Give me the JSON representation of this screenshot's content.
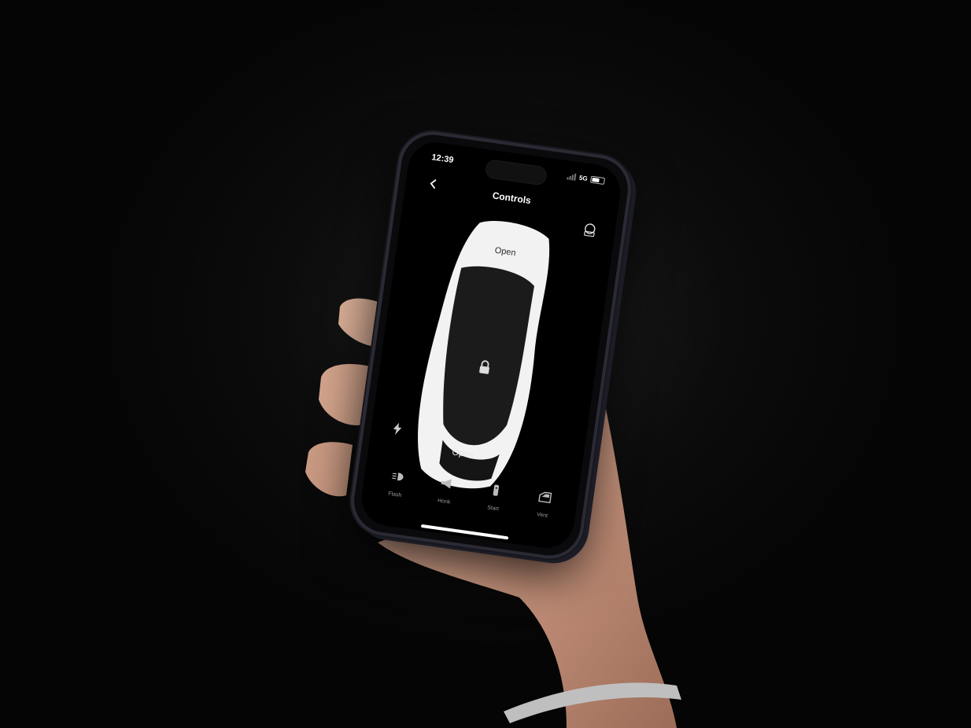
{
  "status": {
    "time": "12:39",
    "network": "5G"
  },
  "header": {
    "title": "Controls",
    "back_icon": "chevron-left-icon",
    "right_icon": "car-service-icon"
  },
  "car": {
    "front_label": "Open",
    "rear_label": "Open",
    "lock_icon": "padlock-icon",
    "charge_icon": "lightning-bolt-icon"
  },
  "actions": [
    {
      "label": "Flash",
      "icon": "headlight-icon"
    },
    {
      "label": "Honk",
      "icon": "horn-icon"
    },
    {
      "label": "Start",
      "icon": "key-fob-icon"
    },
    {
      "label": "Vent",
      "icon": "car-window-icon"
    }
  ],
  "colors": {
    "background": "#0c0c0c",
    "screen": "#000000",
    "car_body": "#f2f2f2"
  }
}
